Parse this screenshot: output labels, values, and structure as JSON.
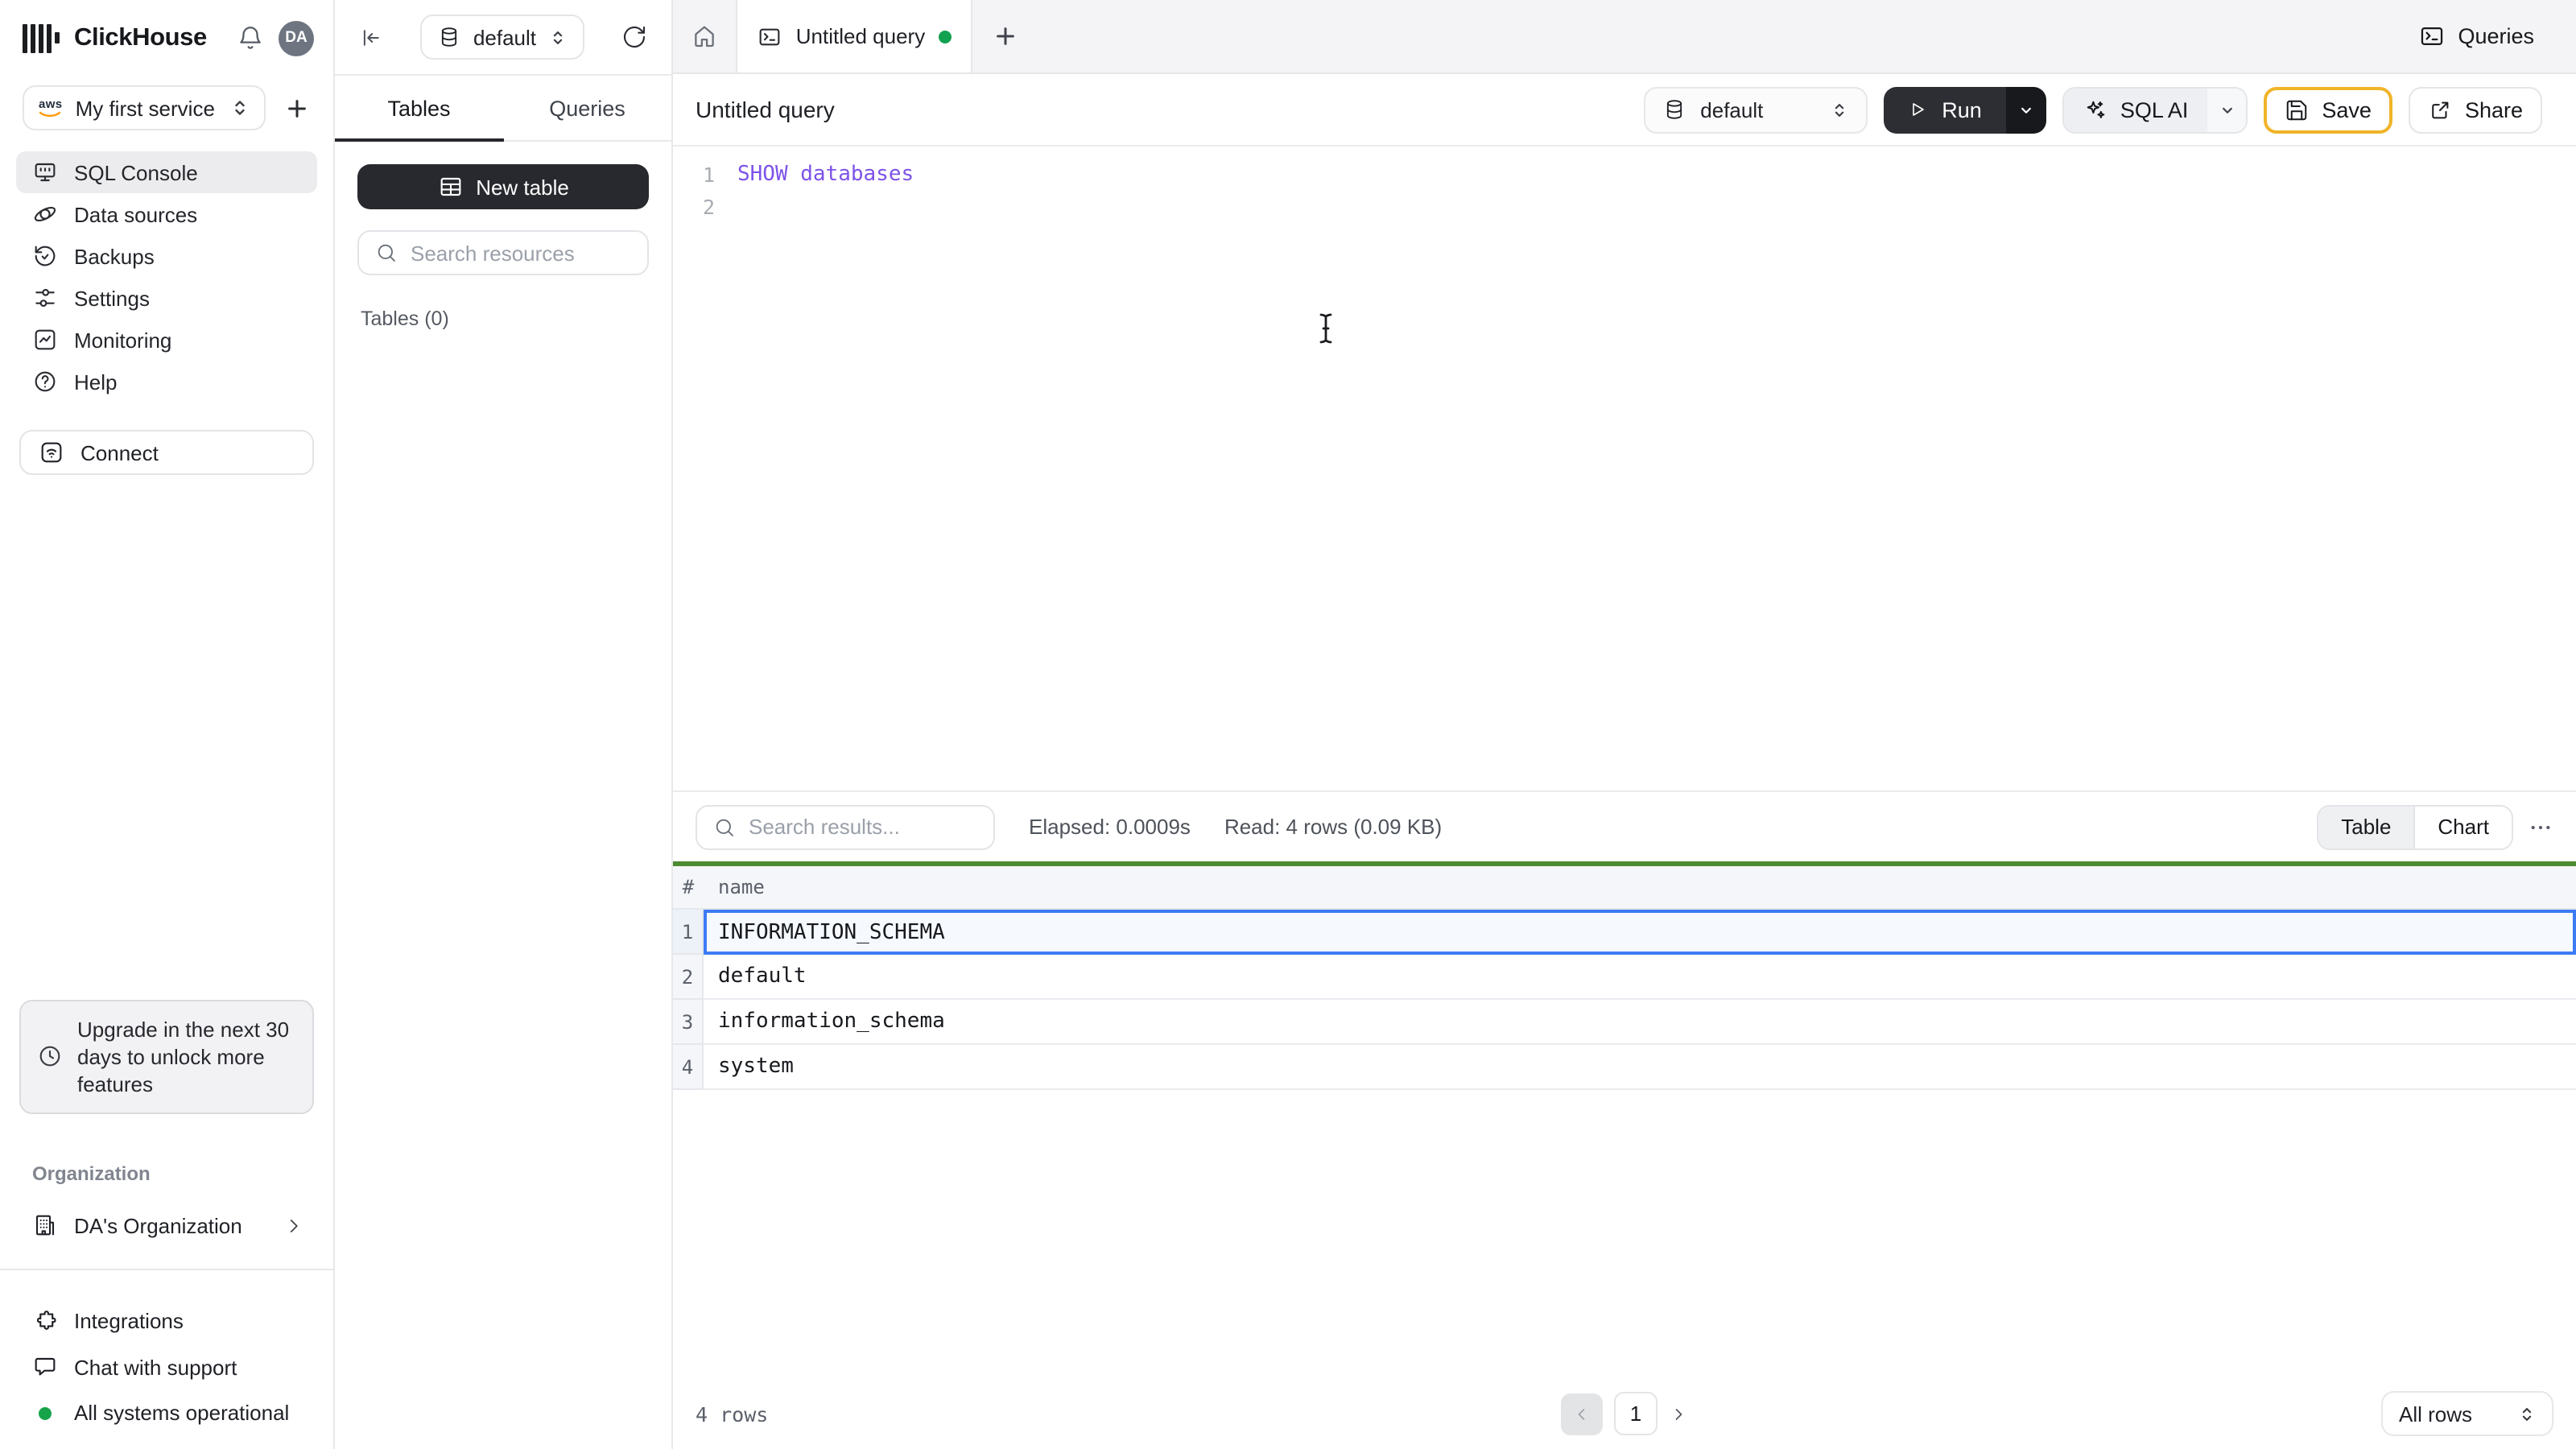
{
  "brand": {
    "name": "ClickHouse",
    "avatar": "DA"
  },
  "sidebar": {
    "service": {
      "provider": "aws",
      "name": "My first service"
    },
    "nav": [
      {
        "label": "SQL Console"
      },
      {
        "label": "Data sources"
      },
      {
        "label": "Backups"
      },
      {
        "label": "Settings"
      },
      {
        "label": "Monitoring"
      },
      {
        "label": "Help"
      }
    ],
    "connect": "Connect",
    "upgrade": "Upgrade in the next 30 days to unlock more features",
    "org_section": "Organization",
    "org_name": "DA's Organization",
    "integrations": "Integrations",
    "chat": "Chat with support",
    "status": "All systems operational"
  },
  "resources": {
    "database": "default",
    "tabs": {
      "tables": "Tables",
      "queries": "Queries"
    },
    "new_table": "New table",
    "search_placeholder": "Search resources",
    "count": "Tables (0)"
  },
  "main": {
    "tabbar": {
      "tab": "Untitled query",
      "queries": "Queries"
    },
    "toolbar": {
      "title": "Untitled query",
      "database": "default",
      "run": "Run",
      "sql_ai": "SQL AI",
      "save": "Save",
      "share": "Share"
    },
    "editor": {
      "line1_num": "1",
      "line1_code": "SHOW databases",
      "line2_num": "2"
    },
    "results": {
      "search_placeholder": "Search results...",
      "elapsed": "Elapsed: 0.0009s",
      "read": "Read: 4 rows (0.09 KB)",
      "toggle": {
        "table": "Table",
        "chart": "Chart"
      },
      "grid": {
        "col_index": "#",
        "col_name": "name",
        "rows": [
          "INFORMATION_SCHEMA",
          "default",
          "information_schema",
          "system"
        ],
        "selected_row": 1
      },
      "footer": {
        "count": "4 rows",
        "page": "1",
        "page_size": "All rows"
      }
    }
  },
  "colors": {
    "accent_green": "#4c8b31",
    "selection_blue": "#3d7bf5",
    "keyword_purple": "#7d53e8",
    "save_border": "#f0b429",
    "status_green": "#17a34a"
  }
}
